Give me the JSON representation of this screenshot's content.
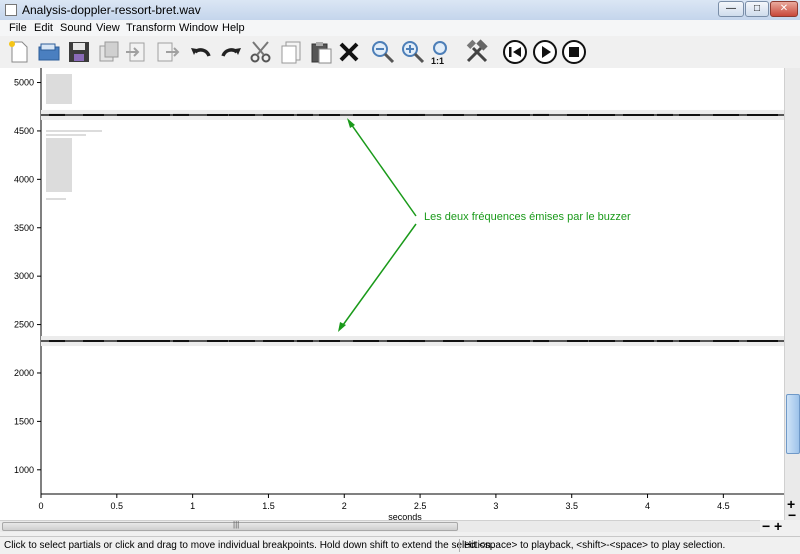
{
  "window": {
    "title": "Analysis-doppler-ressort-bret.wav",
    "minimize_glyph": "—",
    "maximize_glyph": "□",
    "close_glyph": "✕"
  },
  "menu": [
    "File",
    "Edit",
    "Sound",
    "View",
    "Transform",
    "Window",
    "Help"
  ],
  "toolbar": {
    "icons": [
      "new-file-icon",
      "open-file-icon",
      "save-icon",
      "copy-stack-icon",
      "import-icon",
      "export-icon",
      "undo-icon",
      "redo-icon",
      "cut-icon",
      "copy-icon",
      "paste-icon",
      "delete-icon",
      "zoom-out-icon",
      "zoom-in-icon",
      "zoom-reset-icon",
      "tools-icon",
      "rewind-icon",
      "play-icon",
      "stop-icon"
    ],
    "zoom_reset_label": "1:1"
  },
  "plot": {
    "y_ticks": [
      "1000",
      "1500",
      "2000",
      "2500",
      "3000",
      "3500",
      "4000",
      "4500",
      "5000"
    ],
    "x_ticks": [
      "0",
      "0.5",
      "1",
      "1.5",
      "2",
      "2.5",
      "3",
      "3.5",
      "4",
      "4.5"
    ],
    "x_label": "seconds",
    "annotation": "Les deux fréquences émises par le buzzer",
    "annotation_color": "#1a9a1a",
    "partials": [
      {
        "frequency": 4660
      },
      {
        "frequency": 2330
      }
    ]
  },
  "chart_data": {
    "type": "scatter",
    "xlabel": "seconds",
    "ylabel": "",
    "xlim": [
      0,
      4.9
    ],
    "ylim": [
      750,
      5150
    ],
    "series": [
      {
        "x": [
          0,
          0.5,
          1,
          1.5,
          2,
          2.5,
          3,
          3.5,
          4,
          4.5,
          4.9
        ],
        "y": [
          4665,
          4665,
          4665,
          4665,
          4665,
          4665,
          4665,
          4665,
          4665,
          4665,
          4665
        ]
      },
      {
        "x": [
          0,
          0.5,
          1,
          1.5,
          2,
          2.5,
          3,
          3.5,
          4,
          4.5,
          4.9
        ],
        "y": [
          2330,
          2330,
          2330,
          2330,
          2330,
          2330,
          2330,
          2330,
          2330,
          2330,
          2330
        ]
      }
    ]
  },
  "scrollbar": {
    "h_grip": "|||",
    "zoom_in": "+",
    "zoom_out": "−"
  },
  "status": {
    "left": "Click to select partials or click and drag to move individual breakpoints. Hold down shift to extend the selection.",
    "right": "Hit <space> to playback, <shift>-<space> to play selection."
  }
}
